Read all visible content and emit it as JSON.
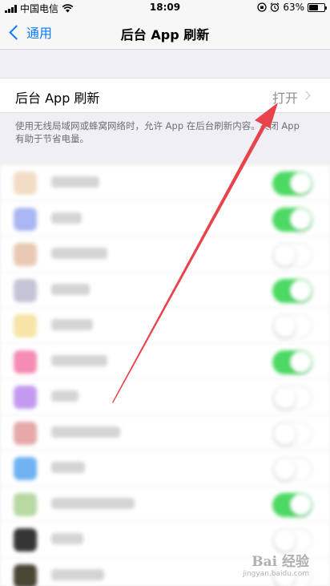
{
  "status_bar": {
    "carrier": "中国电信",
    "time": "18:09",
    "battery_text": "63%",
    "battery_level": 0.63
  },
  "nav": {
    "back_label": "通用",
    "title": "后台 App 刷新"
  },
  "setting": {
    "label": "后台 App 刷新",
    "value": "打开"
  },
  "footer_note": "使用无线局域网或蜂窝网络时，允许 App 在后台刷新内容。关闭 App 有助于节省电量。",
  "app_list": [
    {
      "icon_color": "#f2dcc4",
      "toggle_on": true
    },
    {
      "icon_color": "#a9b6f2",
      "toggle_on": true
    },
    {
      "icon_color": "#e8c9b4",
      "toggle_on": false
    },
    {
      "icon_color": "#c4c4d6",
      "toggle_on": true
    },
    {
      "icon_color": "#f7e4a6",
      "toggle_on": false
    },
    {
      "icon_color": "#f48cb4",
      "toggle_on": true
    },
    {
      "icon_color": "#c49af0",
      "toggle_on": false
    },
    {
      "icon_color": "#e6a8a8",
      "toggle_on": false
    },
    {
      "icon_color": "#6fb2f2",
      "toggle_on": false
    },
    {
      "icon_color": "#b8d8a2",
      "toggle_on": true
    },
    {
      "icon_color": "#353535",
      "toggle_on": false
    },
    {
      "icon_color": "#4a4636",
      "toggle_on": false
    }
  ],
  "colors": {
    "accent": "#0a7cff",
    "toggle_on": "#4cd964",
    "arrow": "#e8434a"
  },
  "watermark": {
    "logo": "Bai 经验",
    "sub": "jingyan.baidu.com"
  }
}
